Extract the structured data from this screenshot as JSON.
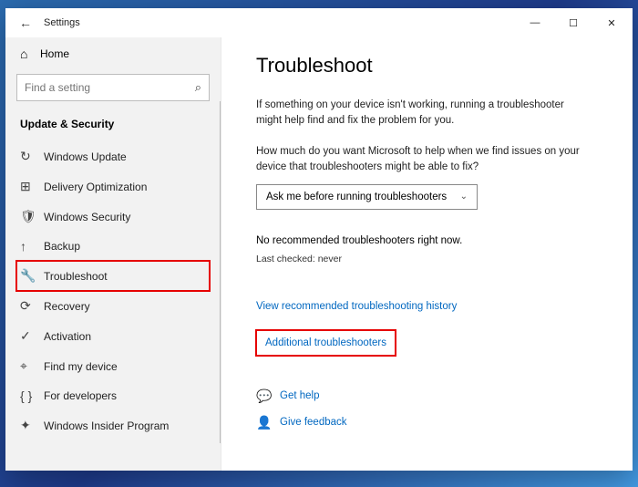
{
  "titlebar": {
    "back": "←",
    "title": "Settings",
    "min": "—",
    "max": "☐",
    "close": "✕"
  },
  "sidebar": {
    "home": "Home",
    "search_placeholder": "Find a setting",
    "section": "Update & Security",
    "items": [
      {
        "icon": "sync",
        "label": "Windows Update"
      },
      {
        "icon": "delivery",
        "label": "Delivery Optimization"
      },
      {
        "icon": "shield",
        "label": "Windows Security"
      },
      {
        "icon": "backup",
        "label": "Backup"
      },
      {
        "icon": "wrench",
        "label": "Troubleshoot"
      },
      {
        "icon": "recovery",
        "label": "Recovery"
      },
      {
        "icon": "activate",
        "label": "Activation"
      },
      {
        "icon": "find",
        "label": "Find my device"
      },
      {
        "icon": "dev",
        "label": "For developers"
      },
      {
        "icon": "insider",
        "label": "Windows Insider Program"
      }
    ]
  },
  "main": {
    "heading": "Troubleshoot",
    "desc": "If something on your device isn't working, running a troubleshooter might help find and fix the problem for you.",
    "question": "How much do you want Microsoft to help when we find issues on your device that troubleshooters might be able to fix?",
    "dropdown": "Ask me before running troubleshooters",
    "no_rec": "No recommended troubleshooters right now.",
    "last_checked": "Last checked: never",
    "link_history": "View recommended troubleshooting history",
    "link_additional": "Additional troubleshooters",
    "get_help": "Get help",
    "give_feedback": "Give feedback"
  }
}
